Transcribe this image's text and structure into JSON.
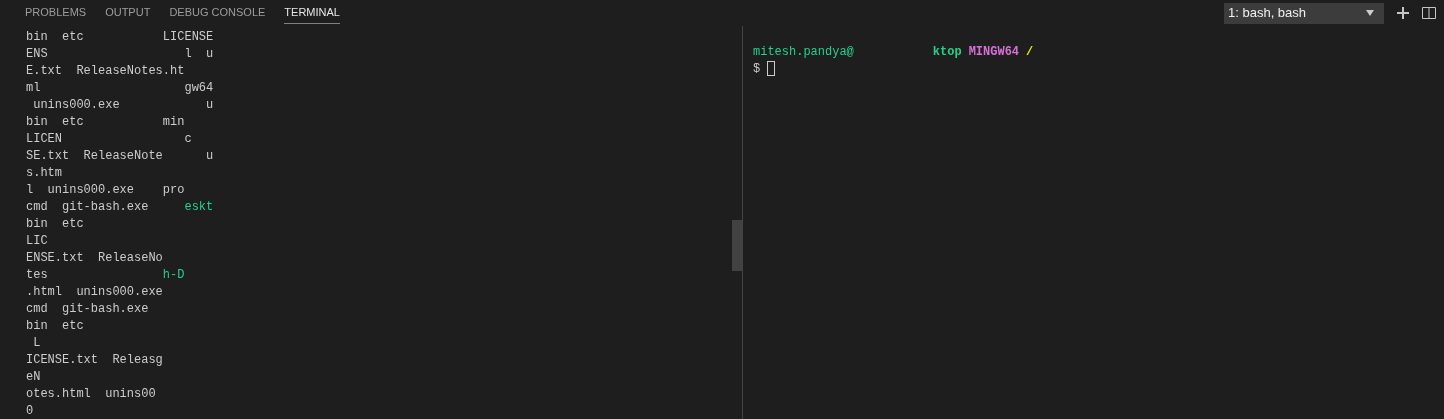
{
  "tabs": [
    {
      "label": "PROBLEMS",
      "selected": false
    },
    {
      "label": "OUTPUT",
      "selected": false
    },
    {
      "label": "DEBUG CONSOLE",
      "selected": false
    },
    {
      "label": "TERMINAL",
      "selected": true
    }
  ],
  "terminal_select": {
    "value": "1: bash, bash"
  },
  "left_terminal": {
    "lines": [
      [
        {
          "text": "bin  etc           LICENSE",
          "color": "#cccccc"
        }
      ],
      [
        {
          "text": "ENS                   l  u",
          "color": "#cccccc"
        }
      ],
      [
        {
          "text": "E.txt  ReleaseNotes.ht",
          "color": "#cccccc"
        }
      ],
      [
        {
          "text": "ml                    gw64",
          "color": "#cccccc"
        }
      ],
      [
        {
          "text": " unins000.exe            u",
          "color": "#cccccc"
        }
      ],
      [
        {
          "text": "bin  etc           min",
          "color": "#cccccc"
        }
      ],
      [
        {
          "text": "LICEN                 c",
          "color": "#cccccc"
        }
      ],
      [
        {
          "text": "SE.txt  ReleaseNote      u",
          "color": "#cccccc"
        }
      ],
      [
        {
          "text": "s.htm",
          "color": "#cccccc"
        }
      ],
      [
        {
          "text": "l  unins000.exe    pro",
          "color": "#cccccc"
        }
      ],
      [
        {
          "text": "cmd  git-bash.exe",
          "color": "#cccccc"
        },
        {
          "text": "     eskt",
          "color": "#23d18b"
        }
      ],
      [
        {
          "text": "bin  etc",
          "color": "#cccccc"
        }
      ],
      [
        {
          "text": "LIC",
          "color": "#cccccc"
        }
      ],
      [
        {
          "text": "ENSE.txt  ReleaseNo",
          "color": "#cccccc"
        }
      ],
      [
        {
          "text": "tes",
          "color": "#cccccc"
        },
        {
          "text": "                h-D",
          "color": "#23d18b"
        }
      ],
      [
        {
          "text": ".html  unins000.exe",
          "color": "#cccccc"
        }
      ],
      [
        {
          "text": "cmd  git-bash.exe",
          "color": "#cccccc"
        }
      ],
      [
        {
          "text": "bin  etc",
          "color": "#cccccc"
        }
      ],
      [
        {
          "text": " L",
          "color": "#cccccc"
        }
      ],
      [
        {
          "text": "ICENSE.txt  Releasg",
          "color": "#cccccc"
        }
      ],
      [
        {
          "text": "eN",
          "color": "#cccccc"
        }
      ],
      [
        {
          "text": "otes.html  unins00",
          "color": "#cccccc"
        }
      ],
      [
        {
          "text": "0",
          "color": "#cccccc"
        }
      ]
    ]
  },
  "right_terminal": {
    "lines": [
      [
        {
          "text": "mitesh.pandya@",
          "color": "#23d18b"
        },
        {
          "text": "          ktop",
          "color": "#23d18b"
        },
        {
          "text": "MINGW64",
          "color": "#d670d6"
        },
        {
          "text": "/",
          "color": "#e5e510"
        }
      ],
      [
        {
          "text": "$",
          "color": "#cccccc"
        }
      ]
    ],
    "cursor": true
  }
}
